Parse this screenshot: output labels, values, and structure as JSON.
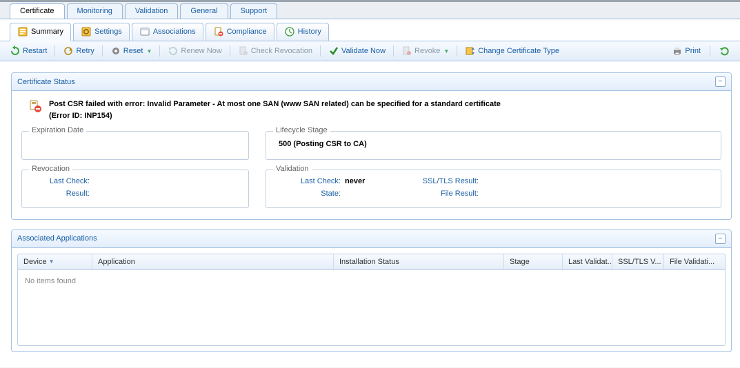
{
  "topTabs": {
    "certificate": "Certificate",
    "monitoring": "Monitoring",
    "validation": "Validation",
    "general": "General",
    "support": "Support"
  },
  "subTabs": {
    "summary": "Summary",
    "settings": "Settings",
    "associations": "Associations",
    "compliance": "Compliance",
    "history": "History"
  },
  "toolbar": {
    "restart": "Restart",
    "retry": "Retry",
    "reset": "Reset",
    "renewNow": "Renew Now",
    "checkRevocation": "Check Revocation",
    "validateNow": "Validate Now",
    "revoke": "Revoke",
    "changeCertType": "Change Certificate Type",
    "print": "Print"
  },
  "status": {
    "panelTitle": "Certificate Status",
    "errorLine1": "Post CSR failed with error: Invalid Parameter - At most one SAN (www SAN related) can be specified for a standard certificate",
    "errorLine2": "(Error ID: INP154)",
    "expiration": {
      "label": "Expiration Date",
      "value": ""
    },
    "lifecycle": {
      "label": "Lifecycle Stage",
      "value": "500 (Posting CSR to CA)"
    },
    "revocation": {
      "label": "Revocation",
      "lastCheckLabel": "Last Check:",
      "lastCheckValue": "",
      "resultLabel": "Result:",
      "resultValue": ""
    },
    "validation": {
      "label": "Validation",
      "lastCheckLabel": "Last Check:",
      "lastCheckValue": "never",
      "stateLabel": "State:",
      "stateValue": "",
      "sslLabel": "SSL/TLS Result:",
      "sslValue": "",
      "fileLabel": "File Result:",
      "fileValue": ""
    }
  },
  "apps": {
    "panelTitle": "Associated Applications",
    "cols": {
      "device": "Device",
      "application": "Application",
      "installStatus": "Installation Status",
      "stage": "Stage",
      "lastValidated": "Last Validat...",
      "ssl": "SSL/TLS V...",
      "fileValid": "File Validati..."
    },
    "empty": "No items found"
  }
}
